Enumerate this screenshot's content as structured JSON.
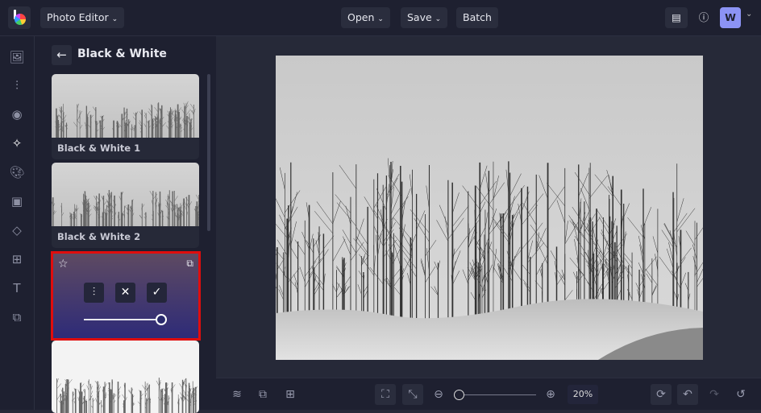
{
  "header": {
    "app_menu": "Photo Editor",
    "open": "Open",
    "save": "Save",
    "batch": "Batch",
    "avatar_initial": "W",
    "accent": "#8c93f5"
  },
  "rail": {
    "items": [
      "image-icon",
      "adjust-icon",
      "eye-icon",
      "effects-icon",
      "palette-icon",
      "frame-icon",
      "shapes-icon",
      "overlay-icon",
      "text-icon",
      "graphics-icon"
    ],
    "active": "effects-icon"
  },
  "panel": {
    "title": "Black & White",
    "back_icon": "arrow-left-icon",
    "items": [
      {
        "label": "Black & White 1"
      },
      {
        "label": "Black & White 2"
      }
    ],
    "selected": {
      "intensity": 100,
      "highlight_color": "#e00d0d"
    }
  },
  "bottom": {
    "zoom": "20%",
    "zoom_slider": 0
  }
}
